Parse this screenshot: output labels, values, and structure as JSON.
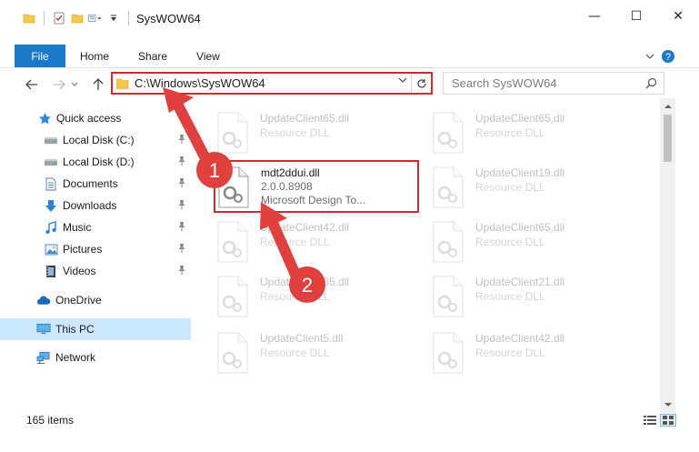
{
  "window": {
    "title": "SysWOW64",
    "minimize_glyph": "—",
    "maximize_glyph": "☐",
    "close_glyph": "✕"
  },
  "ribbon": {
    "tabs": [
      {
        "label": "File"
      },
      {
        "label": "Home"
      },
      {
        "label": "Share"
      },
      {
        "label": "View"
      }
    ]
  },
  "address": {
    "path": "C:\\Windows\\SysWOW64",
    "search_placeholder": "Search SysWOW64"
  },
  "sidebar": {
    "items": [
      {
        "label": "Quick access",
        "icon": "star-icon"
      },
      {
        "label": "Local Disk (C:)",
        "icon": "drive-icon",
        "pinned": true
      },
      {
        "label": "Local Disk (D:)",
        "icon": "drive-icon",
        "pinned": true
      },
      {
        "label": "Documents",
        "icon": "documents-icon",
        "pinned": true
      },
      {
        "label": "Downloads",
        "icon": "download-icon",
        "pinned": true
      },
      {
        "label": "Music",
        "icon": "music-icon",
        "pinned": true
      },
      {
        "label": "Pictures",
        "icon": "pictures-icon",
        "pinned": true
      },
      {
        "label": "Videos",
        "icon": "videos-icon",
        "pinned": true
      },
      {
        "label": "OneDrive",
        "icon": "cloud-icon"
      },
      {
        "label": "This PC",
        "icon": "computer-icon",
        "selected": true
      },
      {
        "label": "Network",
        "icon": "network-icon"
      }
    ]
  },
  "files": {
    "left": [
      {
        "name": "UpdateClient65.dll",
        "type": "Resource DLL"
      },
      {
        "name": "mdt2ddui.dll",
        "version": "2.0.0.8908",
        "desc": "Microsoft Design To..."
      },
      {
        "name": "UpdateClient42.dll",
        "type": "Resource DLL"
      },
      {
        "name": "UpdateClient65.dll",
        "type": "Resource DLL"
      },
      {
        "name": "UpdateClient5.dll",
        "type": "Resource DLL"
      }
    ],
    "right": [
      {
        "name": "UpdateClient65.dll",
        "type": "Resource DLL"
      },
      {
        "name": "UpdateClient19.dll",
        "type": "Resource DLL"
      },
      {
        "name": "UpdateClient65.dll",
        "type": "Resource DLL"
      },
      {
        "name": "UpdateClient21.dll",
        "type": "Resource DLL"
      },
      {
        "name": "UpdateClient42.dll",
        "type": "Resource DLL"
      }
    ]
  },
  "status": {
    "item_count": "165 items"
  },
  "annotations": {
    "badge_1": "1",
    "badge_2": "2"
  },
  "colors": {
    "accent": "#1979ca",
    "highlight_box": "#d22a2a",
    "annotation_red": "#e0413f",
    "selected_nav": "#cce8ff"
  }
}
